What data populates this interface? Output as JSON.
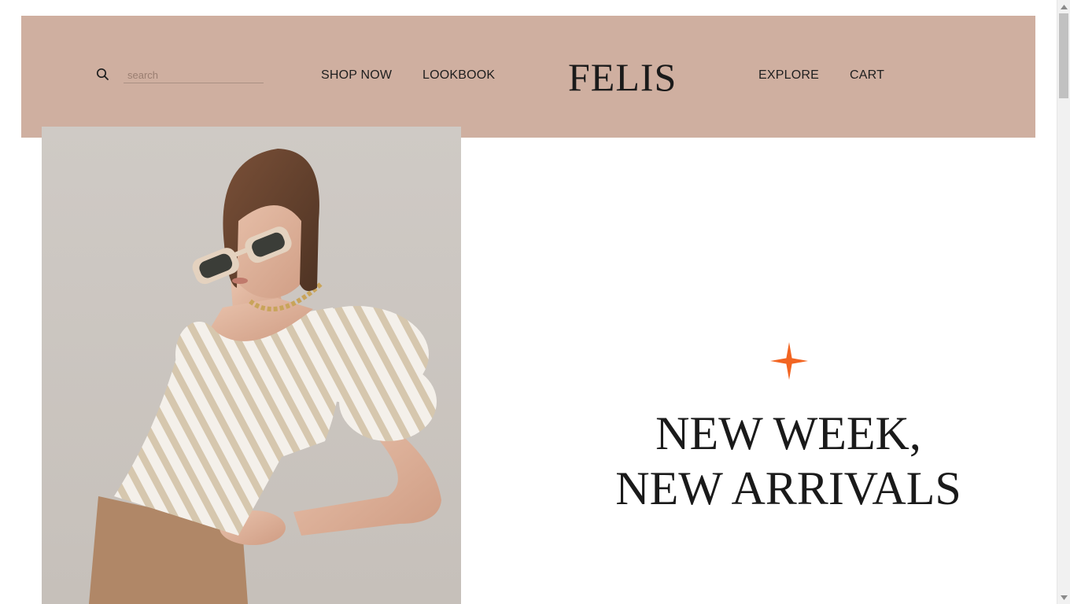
{
  "header": {
    "logo": "FELIS",
    "background_color": "#cfafa0",
    "search": {
      "placeholder": "search",
      "value": "",
      "icon": "search-icon"
    },
    "nav_left": [
      {
        "label": "SHOP NOW"
      },
      {
        "label": "LOOKBOOK"
      }
    ],
    "nav_right": [
      {
        "label": "EXPLORE"
      },
      {
        "label": "CART"
      }
    ]
  },
  "hero": {
    "image": "fashion model wearing sunglasses, gold chain necklace and striped puff-sleeve blouse",
    "star_icon": "four-point-star-icon",
    "star_color": "#f26522",
    "headline": {
      "line1": "NEW WEEK,",
      "line2": "NEW ARRIVALS"
    }
  },
  "scrollbar": {
    "thumb_color": "#c1c1c1",
    "track_color": "#f1f1f1"
  }
}
